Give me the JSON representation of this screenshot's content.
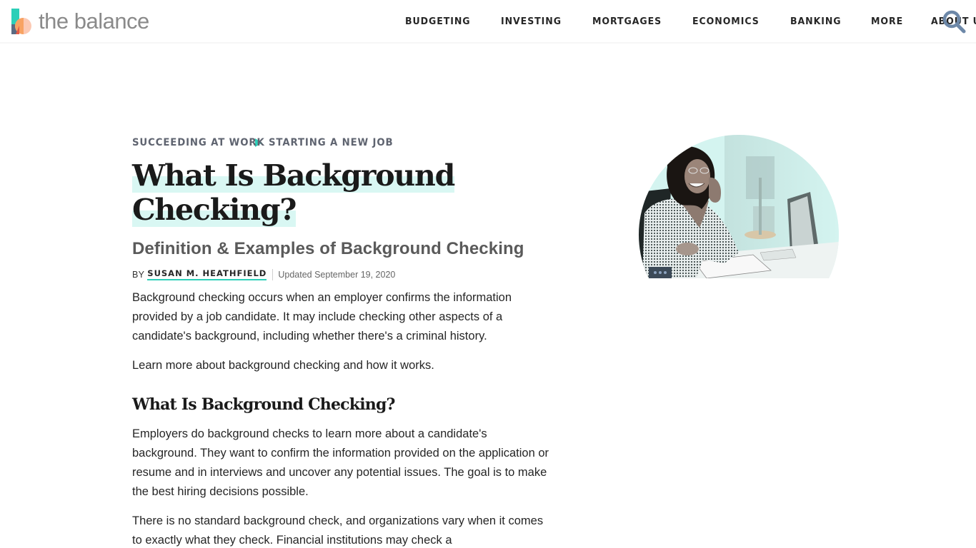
{
  "header": {
    "logo_text": "the balance",
    "nav": [
      {
        "label": "BUDGETING"
      },
      {
        "label": "INVESTING"
      },
      {
        "label": "MORTGAGES"
      },
      {
        "label": "ECONOMICS"
      },
      {
        "label": "BANKING"
      },
      {
        "label": "MORE"
      },
      {
        "label": "ABOUT US"
      }
    ],
    "search_icon": "search-icon"
  },
  "article": {
    "breadcrumb": [
      "SUCCEEDING AT WORK",
      "STARTING A NEW JOB"
    ],
    "title_line1": "What Is Background",
    "title_line2": "Checking?",
    "subtitle": "Definition & Examples of Background Checking",
    "byline": {
      "by": "BY",
      "author": "SUSAN M. HEATHFIELD",
      "updated": "Updated September 19, 2020"
    },
    "paragraphs": [
      "Background checking occurs when an employer confirms the information provided by a job candidate. It may include checking other aspects of a candidate's background, including whether there's a criminal history.",
      "Learn more about background checking and how it works."
    ],
    "section_heading": "What Is Background Checking?",
    "section_paragraphs": [
      "Employers do background checks to learn more about a candidate's background. They want to confirm the information provided on the application or resume and in interviews and uncover any potential issues. The goal is to make the best hiring decisions possible.",
      "There is no standard background check, and organizations vary when it comes to exactly what they check. Financial institutions may check a"
    ],
    "hero_image": {
      "alt": "Woman smiling while talking on phone at desk",
      "icon": "more-dots-icon"
    }
  },
  "colors": {
    "accent_teal": "#2ccfb8",
    "highlight": "#d9f7f3",
    "search_icon": "#6d88a8",
    "logo_gray": "#8a8a8a"
  }
}
